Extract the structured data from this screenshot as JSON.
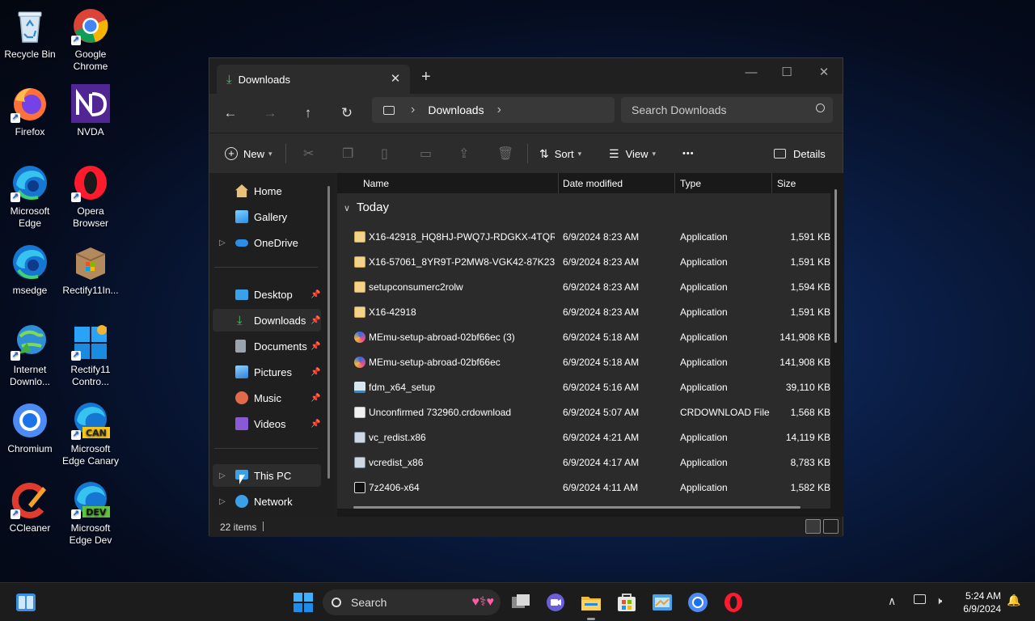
{
  "desktop": {
    "icons": [
      {
        "label": "Recycle Bin"
      },
      {
        "label": "Google Chrome"
      },
      {
        "label": "Firefox"
      },
      {
        "label": "NVDA"
      },
      {
        "label": "Microsoft Edge"
      },
      {
        "label": "Opera Browser"
      },
      {
        "label": "msedge"
      },
      {
        "label": "Rectify11In..."
      },
      {
        "label": "Internet Downlo..."
      },
      {
        "label": "Rectify11 Contro..."
      },
      {
        "label": "Chromium"
      },
      {
        "label": "Microsoft Edge Canary",
        "badge": "CAN"
      },
      {
        "label": "CCleaner"
      },
      {
        "label": "Microsoft Edge Dev",
        "badge": "DEV"
      }
    ]
  },
  "explorer": {
    "tab_title": "Downloads",
    "tab_close": "✕",
    "new_tab": "+",
    "window_controls": {
      "minimize": "—",
      "maximize": "☐",
      "close": "✕"
    },
    "address": {
      "location": "Downloads",
      "sep": "›"
    },
    "search_placeholder": "Search Downloads",
    "toolbar": {
      "new": "New",
      "sort": "Sort",
      "view": "View",
      "more": "•••",
      "details": "Details"
    },
    "nav": {
      "home": "Home",
      "gallery": "Gallery",
      "onedrive": "OneDrive",
      "desktop": "Desktop",
      "downloads": "Downloads",
      "documents": "Documents",
      "pictures": "Pictures",
      "music": "Music",
      "videos": "Videos",
      "thispc": "This PC",
      "network": "Network"
    },
    "columns": {
      "name": "Name",
      "date": "Date modified",
      "type": "Type",
      "size": "Size"
    },
    "group": "Today",
    "files": [
      {
        "name": "X16-42918_HQ8HJ-PWQ7J-RDGKX-4TQR...",
        "date": "6/9/2024 8:23 AM",
        "type": "Application",
        "size": "1,591 KB",
        "icon": "installer"
      },
      {
        "name": "X16-57061_8YR9T-P2MW8-VGK42-87K23-...",
        "date": "6/9/2024 8:23 AM",
        "type": "Application",
        "size": "1,591 KB",
        "icon": "installer"
      },
      {
        "name": "setupconsumerc2rolw",
        "date": "6/9/2024 8:23 AM",
        "type": "Application",
        "size": "1,594 KB",
        "icon": "installer"
      },
      {
        "name": "X16-42918",
        "date": "6/9/2024 8:23 AM",
        "type": "Application",
        "size": "1,591 KB",
        "icon": "installer"
      },
      {
        "name": "MEmu-setup-abroad-02bf66ec (3)",
        "date": "6/9/2024 5:18 AM",
        "type": "Application",
        "size": "141,908 KB",
        "icon": "memu"
      },
      {
        "name": "MEmu-setup-abroad-02bf66ec",
        "date": "6/9/2024 5:18 AM",
        "type": "Application",
        "size": "141,908 KB",
        "icon": "memu"
      },
      {
        "name": "fdm_x64_setup",
        "date": "6/9/2024 5:16 AM",
        "type": "Application",
        "size": "39,110 KB",
        "icon": "fdm"
      },
      {
        "name": "Unconfirmed 732960.crdownload",
        "date": "6/9/2024 5:07 AM",
        "type": "CRDOWNLOAD File",
        "size": "1,568 KB",
        "icon": "blank"
      },
      {
        "name": "vc_redist.x86",
        "date": "6/9/2024 4:21 AM",
        "type": "Application",
        "size": "14,119 KB",
        "icon": "vcredist"
      },
      {
        "name": "vcredist_x86",
        "date": "6/9/2024 4:17 AM",
        "type": "Application",
        "size": "8,783 KB",
        "icon": "vcredist"
      },
      {
        "name": "7z2406-x64",
        "date": "6/9/2024 4:11 AM",
        "type": "Application",
        "size": "1,582 KB",
        "icon": "7z"
      }
    ],
    "status": {
      "items": "22 items"
    }
  },
  "taskbar": {
    "search_label": "Search",
    "time": "5:24 AM",
    "date": "6/9/2024"
  },
  "colors": {
    "accent": "#60cdff",
    "window_bg": "#202020",
    "list_bg": "#2b2b2b"
  }
}
